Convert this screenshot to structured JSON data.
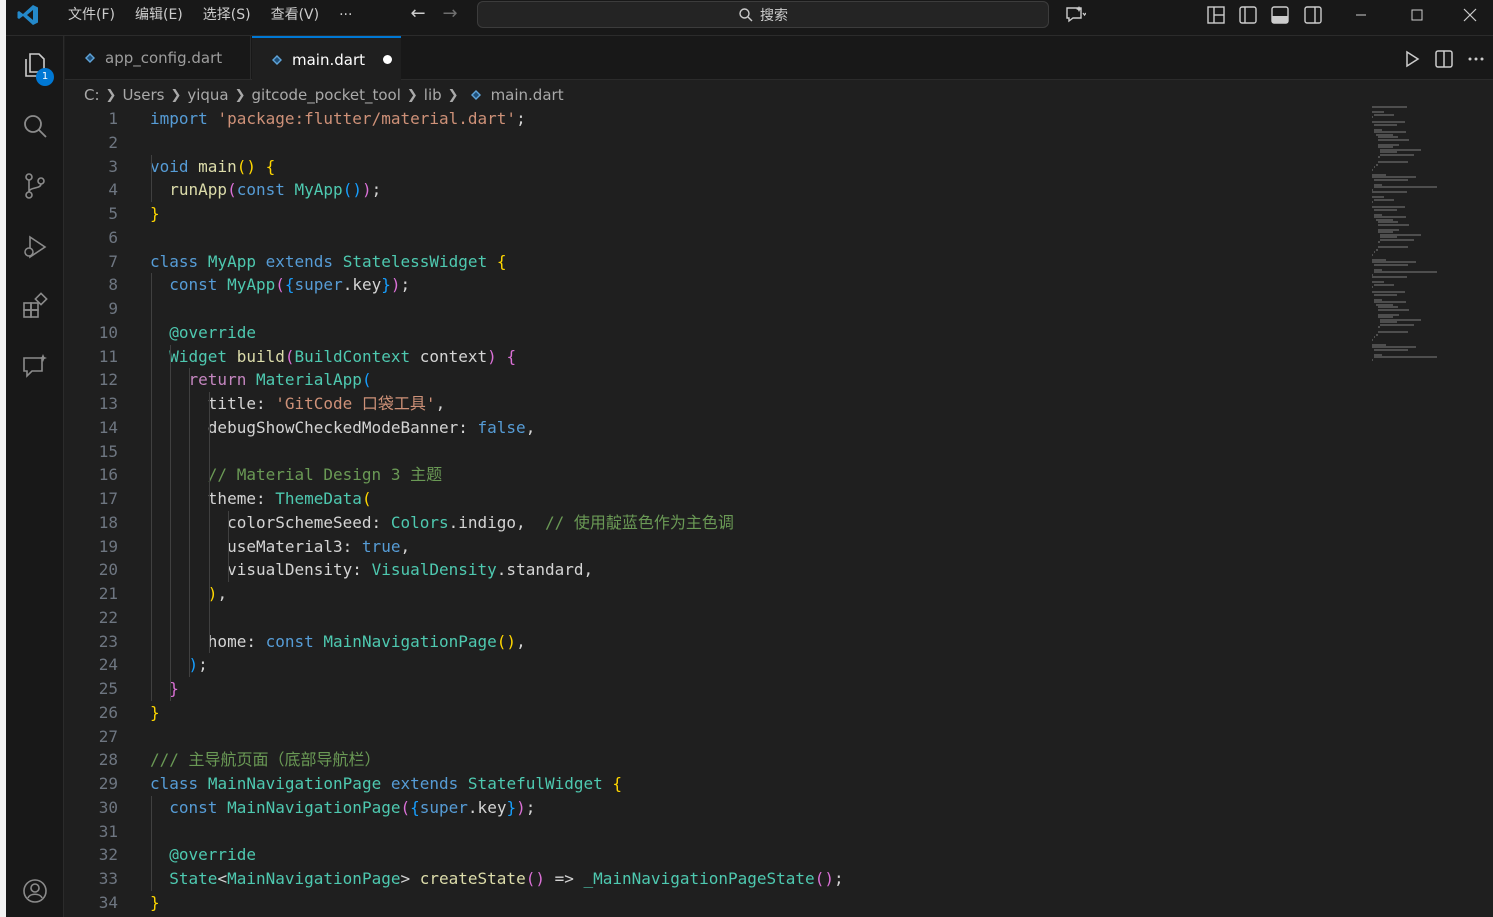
{
  "titlebar": {
    "menu": [
      "文件(F)",
      "编辑(E)",
      "选择(S)",
      "查看(V)",
      "···"
    ],
    "search_placeholder": "搜索"
  },
  "activity": {
    "explorer_badge": "1"
  },
  "tabs": [
    {
      "label": "app_config.dart",
      "active": false
    },
    {
      "label": "main.dart",
      "active": true,
      "dirty": true
    }
  ],
  "breadcrumb": [
    "C:",
    "Users",
    "yiqua",
    "gitcode_pocket_tool",
    "lib",
    "main.dart"
  ],
  "editor": {
    "line_numbers": [
      "1",
      "2",
      "3",
      "4",
      "5",
      "6",
      "7",
      "8",
      "9",
      "10",
      "11",
      "12",
      "13",
      "14",
      "15",
      "16",
      "17",
      "18",
      "19",
      "20",
      "21",
      "22",
      "23",
      "24",
      "25",
      "26",
      "27",
      "28",
      "29",
      "30",
      "31",
      "32",
      "33",
      "34"
    ],
    "lines": [
      [
        [
          "kw",
          "import"
        ],
        [
          "var",
          " "
        ],
        [
          "str",
          "'package:flutter/material.dart'"
        ],
        [
          "var",
          ";"
        ]
      ],
      [],
      [
        [
          "kw",
          "void"
        ],
        [
          "var",
          " "
        ],
        [
          "fn",
          "main"
        ],
        [
          "b1",
          "()"
        ],
        [
          "var",
          " "
        ],
        [
          "b1",
          "{"
        ]
      ],
      [
        [
          "var",
          "  "
        ],
        [
          "fn",
          "runApp"
        ],
        [
          "b2",
          "("
        ],
        [
          "kw",
          "const"
        ],
        [
          "var",
          " "
        ],
        [
          "cls",
          "MyApp"
        ],
        [
          "b3",
          "()"
        ],
        [
          "b2",
          ")"
        ],
        [
          "var",
          ";"
        ]
      ],
      [
        [
          "b1",
          "}"
        ]
      ],
      [],
      [
        [
          "kw",
          "class"
        ],
        [
          "var",
          " "
        ],
        [
          "cls",
          "MyApp"
        ],
        [
          "var",
          " "
        ],
        [
          "kw",
          "extends"
        ],
        [
          "var",
          " "
        ],
        [
          "cls",
          "StatelessWidget"
        ],
        [
          "var",
          " "
        ],
        [
          "b1",
          "{"
        ]
      ],
      [
        [
          "var",
          "  "
        ],
        [
          "kw",
          "const"
        ],
        [
          "var",
          " "
        ],
        [
          "cls",
          "MyApp"
        ],
        [
          "b2",
          "("
        ],
        [
          "b3",
          "{"
        ],
        [
          "kw",
          "super"
        ],
        [
          "var",
          ".key"
        ],
        [
          "b3",
          "}"
        ],
        [
          "b2",
          ")"
        ],
        [
          "var",
          ";"
        ]
      ],
      [],
      [
        [
          "var",
          "  "
        ],
        [
          "ann",
          "@override"
        ]
      ],
      [
        [
          "var",
          "  "
        ],
        [
          "cls",
          "Widget"
        ],
        [
          "var",
          " "
        ],
        [
          "fn",
          "build"
        ],
        [
          "b2",
          "("
        ],
        [
          "cls",
          "BuildContext"
        ],
        [
          "var",
          " context"
        ],
        [
          "b2",
          ")"
        ],
        [
          "var",
          " "
        ],
        [
          "b2",
          "{"
        ]
      ],
      [
        [
          "var",
          "    "
        ],
        [
          "ctl",
          "return"
        ],
        [
          "var",
          " "
        ],
        [
          "cls",
          "MaterialApp"
        ],
        [
          "b3",
          "("
        ]
      ],
      [
        [
          "var",
          "      title: "
        ],
        [
          "str",
          "'GitCode 口袋工具'"
        ],
        [
          "var",
          ","
        ]
      ],
      [
        [
          "var",
          "      debugShowCheckedModeBanner: "
        ],
        [
          "kw",
          "false"
        ],
        [
          "var",
          ","
        ]
      ],
      [],
      [
        [
          "var",
          "      "
        ],
        [
          "cmt",
          "// Material Design 3 主题"
        ]
      ],
      [
        [
          "var",
          "      theme: "
        ],
        [
          "cls",
          "ThemeData"
        ],
        [
          "b1",
          "("
        ]
      ],
      [
        [
          "var",
          "        colorSchemeSeed: "
        ],
        [
          "cls",
          "Colors"
        ],
        [
          "var",
          ".indigo,  "
        ],
        [
          "cmt",
          "// 使用靛蓝色作为主色调"
        ]
      ],
      [
        [
          "var",
          "        useMaterial3: "
        ],
        [
          "kw",
          "true"
        ],
        [
          "var",
          ","
        ]
      ],
      [
        [
          "var",
          "        visualDensity: "
        ],
        [
          "cls",
          "VisualDensity"
        ],
        [
          "var",
          ".standard,"
        ]
      ],
      [
        [
          "var",
          "      "
        ],
        [
          "b1",
          ")"
        ],
        [
          "var",
          ","
        ]
      ],
      [],
      [
        [
          "var",
          "      home: "
        ],
        [
          "kw",
          "const"
        ],
        [
          "var",
          " "
        ],
        [
          "cls",
          "MainNavigationPage"
        ],
        [
          "b1",
          "()"
        ],
        [
          "var",
          ","
        ]
      ],
      [
        [
          "var",
          "    "
        ],
        [
          "b3",
          ")"
        ],
        [
          "var",
          ";"
        ]
      ],
      [
        [
          "var",
          "  "
        ],
        [
          "b2",
          "}"
        ]
      ],
      [
        [
          "b1",
          "}"
        ]
      ],
      [],
      [
        [
          "cmt",
          "/// 主导航页面（底部导航栏）"
        ]
      ],
      [
        [
          "kw",
          "class"
        ],
        [
          "var",
          " "
        ],
        [
          "cls",
          "MainNavigationPage"
        ],
        [
          "var",
          " "
        ],
        [
          "kw",
          "extends"
        ],
        [
          "var",
          " "
        ],
        [
          "cls",
          "StatefulWidget"
        ],
        [
          "var",
          " "
        ],
        [
          "b1",
          "{"
        ]
      ],
      [
        [
          "var",
          "  "
        ],
        [
          "kw",
          "const"
        ],
        [
          "var",
          " "
        ],
        [
          "cls",
          "MainNavigationPage"
        ],
        [
          "b2",
          "("
        ],
        [
          "b3",
          "{"
        ],
        [
          "kw",
          "super"
        ],
        [
          "var",
          ".key"
        ],
        [
          "b3",
          "}"
        ],
        [
          "b2",
          ")"
        ],
        [
          "var",
          ";"
        ]
      ],
      [],
      [
        [
          "var",
          "  "
        ],
        [
          "ann",
          "@override"
        ]
      ],
      [
        [
          "var",
          "  "
        ],
        [
          "cls",
          "State"
        ],
        [
          "var",
          "<"
        ],
        [
          "cls",
          "MainNavigationPage"
        ],
        [
          "var",
          "> "
        ],
        [
          "fn",
          "createState"
        ],
        [
          "b2",
          "()"
        ],
        [
          "var",
          " => "
        ],
        [
          "cls",
          "_MainNavigationPageState"
        ],
        [
          "b2",
          "()"
        ],
        [
          "var",
          ";"
        ]
      ],
      [
        [
          "b1",
          "}"
        ]
      ]
    ]
  },
  "colors": {
    "accent": "#0078d4",
    "editor_bg": "#1f1f1f",
    "chrome_bg": "#181818"
  }
}
